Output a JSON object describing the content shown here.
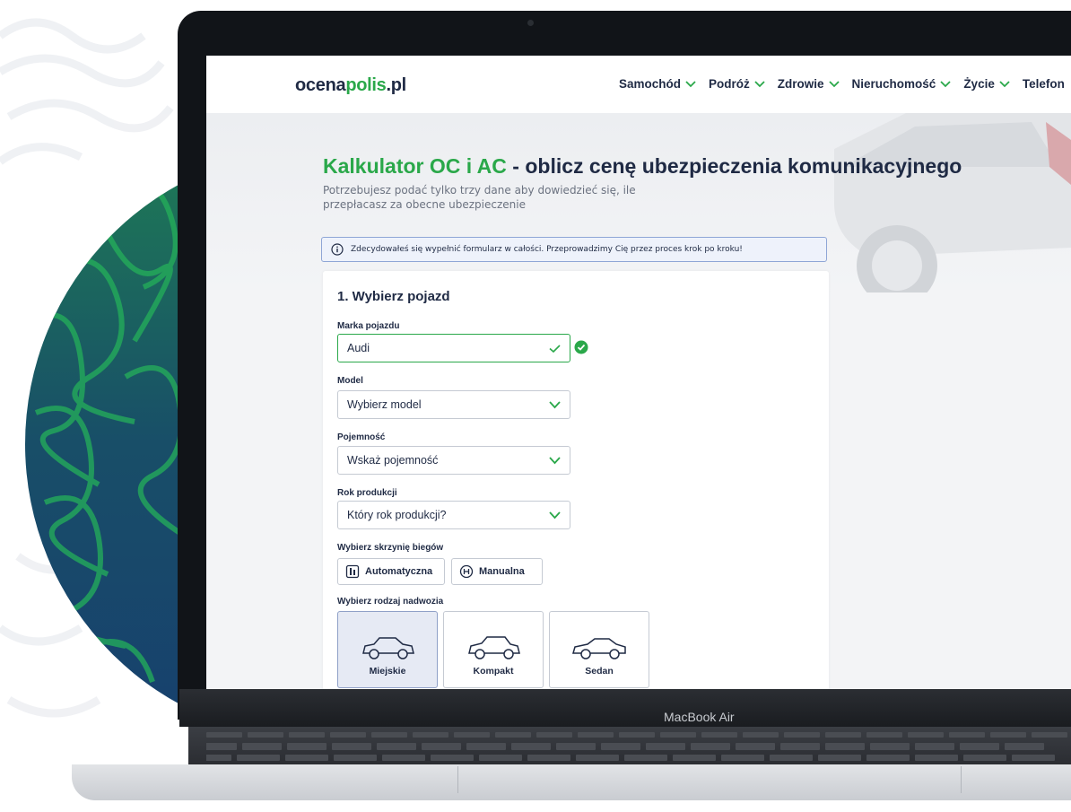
{
  "device": {
    "model_label": "MacBook Air"
  },
  "site": {
    "logo": {
      "part1": "ocena",
      "part2": "polis",
      "part3": ".pl"
    },
    "nav": [
      {
        "label": "Samochód"
      },
      {
        "label": "Podróż"
      },
      {
        "label": "Zdrowie"
      },
      {
        "label": "Nieruchomość"
      },
      {
        "label": "Życie"
      },
      {
        "label": "Telefon"
      }
    ]
  },
  "page": {
    "title_green": "Kalkulator OC i AC",
    "title_rest": " - oblicz cenę ubezpieczenia komunikacyjnego",
    "subtitle": "Potrzebujesz podać tylko trzy dane aby dowiedzieć się, ile przepłacasz za obecne ubezpieczenie",
    "info_text": "Zdecydowałeś się wypełnić formularz w całości. Przeprowadzimy Cię przez proces krok po kroku!"
  },
  "form": {
    "step_title": "1. Wybierz pojazd",
    "make": {
      "label": "Marka pojazdu",
      "value": "Audi"
    },
    "model": {
      "label": "Model",
      "value": "Wybierz model"
    },
    "capacity": {
      "label": "Pojemność",
      "value": "Wskaż pojemność"
    },
    "year": {
      "label": "Rok produkcji",
      "value": "Który rok produkcji?"
    },
    "gearbox": {
      "label": "Wybierz skrzynię biegów",
      "options": [
        "Automatyczna",
        "Manualna"
      ]
    },
    "body": {
      "label": "Wybierz rodzaj nadwozia",
      "options": [
        "Miejskie",
        "Kompakt",
        "Sedan"
      ],
      "selected": "Miejskie"
    }
  },
  "colors": {
    "brand_green": "#2aa84a",
    "navy": "#1f2a44",
    "selected_bg": "#e6eaf4"
  }
}
